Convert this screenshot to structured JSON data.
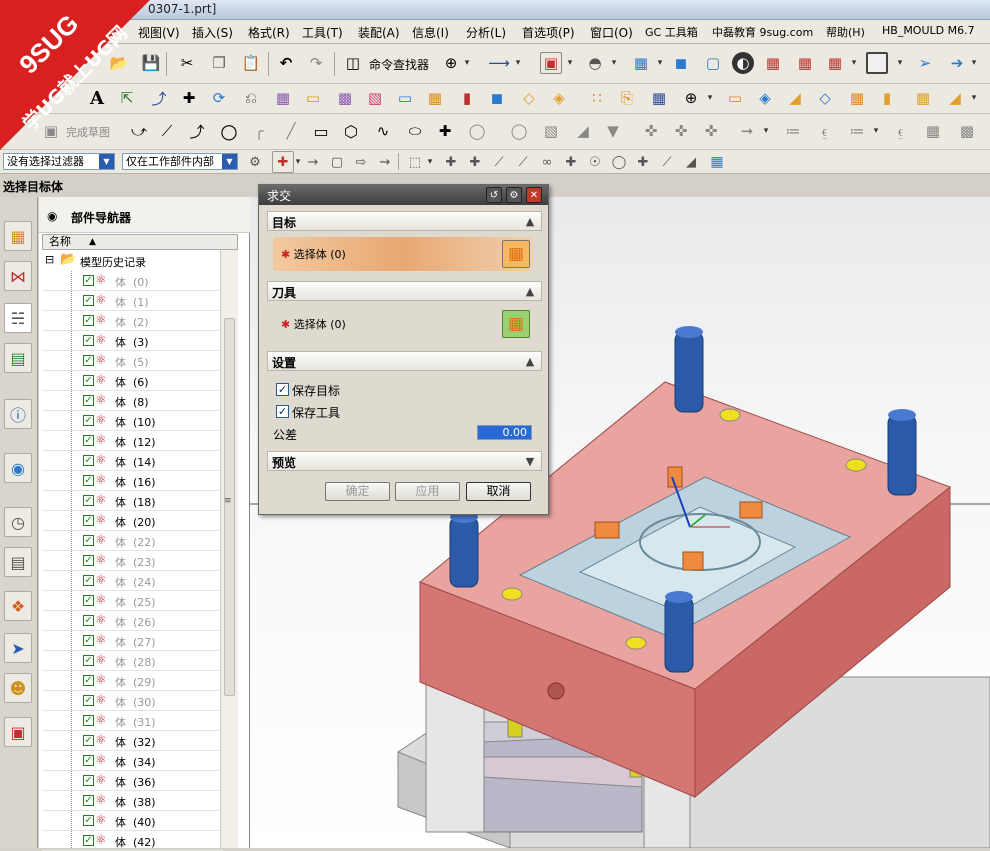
{
  "title_fragment": "0307-1.prt]",
  "menu": [
    "视图(V)",
    "插入(S)",
    "格式(R)",
    "工具(T)",
    "装配(A)",
    "信息(I)",
    "分析(L)",
    "首选项(P)",
    "窗口(O)",
    "GC 工具箱",
    "中磊教育 9sug.com",
    "帮助(H)",
    "HB_MOULD M6.7"
  ],
  "toolbar": {
    "command_finder": "命令查找器",
    "finish_sketch": "完成草图"
  },
  "filter": {
    "type_filter": "没有选择过滤器",
    "scope_filter": "仅在工作部件内部"
  },
  "prompt": "选择目标体",
  "navigator": {
    "title": "部件导航器",
    "column_name": "名称",
    "root": "模型历史记录",
    "items": [
      {
        "label": "体",
        "num": "(0)",
        "dim": true
      },
      {
        "label": "体",
        "num": "(1)",
        "dim": true
      },
      {
        "label": "体",
        "num": "(2)",
        "dim": true
      },
      {
        "label": "体",
        "num": "(3)",
        "dim": false
      },
      {
        "label": "体",
        "num": "(5)",
        "dim": true
      },
      {
        "label": "体",
        "num": "(6)",
        "dim": false
      },
      {
        "label": "体",
        "num": "(8)",
        "dim": false
      },
      {
        "label": "体",
        "num": "(10)",
        "dim": false
      },
      {
        "label": "体",
        "num": "(12)",
        "dim": false
      },
      {
        "label": "体",
        "num": "(14)",
        "dim": false
      },
      {
        "label": "体",
        "num": "(16)",
        "dim": false
      },
      {
        "label": "体",
        "num": "(18)",
        "dim": false
      },
      {
        "label": "体",
        "num": "(20)",
        "dim": false
      },
      {
        "label": "体",
        "num": "(22)",
        "dim": true
      },
      {
        "label": "体",
        "num": "(23)",
        "dim": true
      },
      {
        "label": "体",
        "num": "(24)",
        "dim": true
      },
      {
        "label": "体",
        "num": "(25)",
        "dim": true
      },
      {
        "label": "体",
        "num": "(26)",
        "dim": true
      },
      {
        "label": "体",
        "num": "(27)",
        "dim": true
      },
      {
        "label": "体",
        "num": "(28)",
        "dim": true
      },
      {
        "label": "体",
        "num": "(29)",
        "dim": true
      },
      {
        "label": "体",
        "num": "(30)",
        "dim": true
      },
      {
        "label": "体",
        "num": "(31)",
        "dim": true
      },
      {
        "label": "体",
        "num": "(32)",
        "dim": false
      },
      {
        "label": "体",
        "num": "(34)",
        "dim": false
      },
      {
        "label": "体",
        "num": "(36)",
        "dim": false
      },
      {
        "label": "体",
        "num": "(38)",
        "dim": false
      },
      {
        "label": "体",
        "num": "(40)",
        "dim": false
      },
      {
        "label": "体",
        "num": "(42)",
        "dim": false
      }
    ]
  },
  "dialog": {
    "title": "求交",
    "target_section": "目标",
    "target_select": "选择体 (0)",
    "tool_section": "刀具",
    "tool_select": "选择体 (0)",
    "settings_section": "设置",
    "keep_target": "保存目标",
    "keep_tool": "保存工具",
    "tolerance_label": "公差",
    "tolerance_value": "0.00",
    "preview_section": "预览",
    "ok": "确定",
    "apply": "应用",
    "cancel": "取消"
  },
  "watermark": {
    "brand": "9SUG",
    "slogan": "学UG就上UG网"
  },
  "colors": {
    "accent": "#2a5db0",
    "mold_pink": "#e79a96",
    "dialog_target_highlight": "#e8a872"
  }
}
